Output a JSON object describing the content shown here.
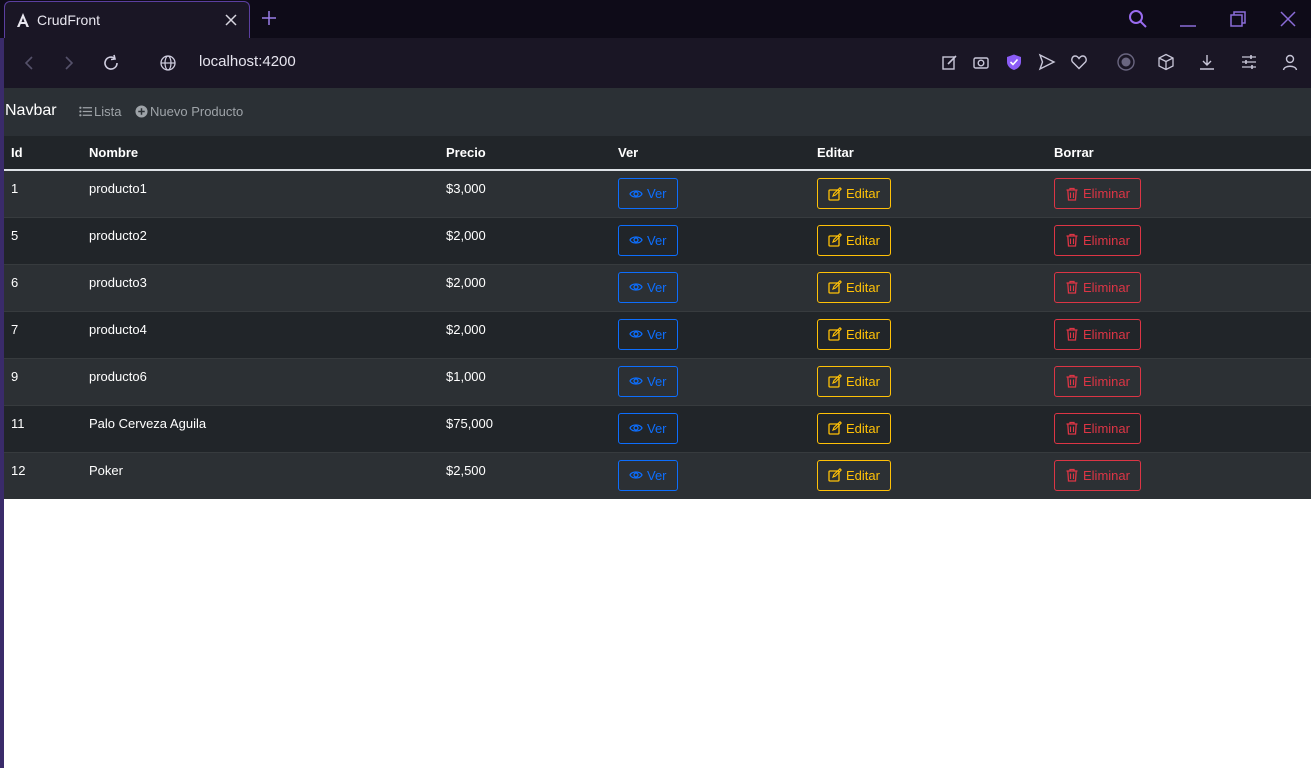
{
  "browser": {
    "tab_title": "CrudFront",
    "url": "localhost:4200"
  },
  "navbar": {
    "brand": "Navbar",
    "links": [
      {
        "label": "Lista",
        "icon": "list-icon"
      },
      {
        "label": "Nuevo Producto",
        "icon": "plus-circle-icon"
      }
    ]
  },
  "table": {
    "headers": [
      "Id",
      "Nombre",
      "Precio",
      "Ver",
      "Editar",
      "Borrar"
    ],
    "rows": [
      {
        "id": "1",
        "nombre": "producto1",
        "precio": "$3,000"
      },
      {
        "id": "5",
        "nombre": "producto2",
        "precio": "$2,000"
      },
      {
        "id": "6",
        "nombre": "producto3",
        "precio": "$2,000"
      },
      {
        "id": "7",
        "nombre": "producto4",
        "precio": "$2,000"
      },
      {
        "id": "9",
        "nombre": "producto6",
        "precio": "$1,000"
      },
      {
        "id": "11",
        "nombre": "Palo Cerveza Aguila",
        "precio": "$75,000"
      },
      {
        "id": "12",
        "nombre": "Poker",
        "precio": "$2,500"
      }
    ],
    "buttons": {
      "ver": "Ver",
      "editar": "Editar",
      "eliminar": "Eliminar"
    }
  },
  "colors": {
    "ver": "#0d6efd",
    "editar": "#ffc107",
    "eliminar": "#dc3545",
    "accent": "#8b5cf6"
  }
}
